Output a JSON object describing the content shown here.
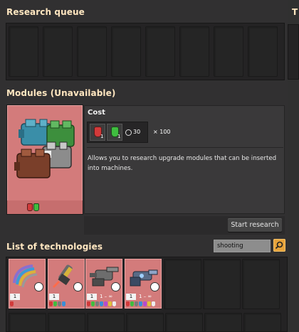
{
  "research_queue": {
    "title": "Research queue",
    "slots": 8
  },
  "header_cut": "T",
  "selected_tech": {
    "title": "Modules (Unavailable)",
    "cost_label": "Cost",
    "cost_items": [
      {
        "icon": "red-science-pack-icon",
        "count": "1",
        "color": "#d23a3a"
      },
      {
        "icon": "green-science-pack-icon",
        "count": "1",
        "color": "#3fbd3f"
      }
    ],
    "time": "30",
    "multiplier": "× 100",
    "description": "Allows you to research upgrade modules that can be inserted into machines.",
    "start_button": "Start research"
  },
  "technologies": {
    "title": "List of technologies",
    "search_value": "shooting",
    "cards": [
      {
        "name": "physical-projectile-damage",
        "level": "1",
        "range": ""
      },
      {
        "name": "weapon-shooting-speed",
        "level": "1",
        "range": ""
      },
      {
        "name": "stronger-explosives",
        "level": "1",
        "range": "1 – ∞"
      },
      {
        "name": "laser-shooting-speed",
        "level": "1",
        "range": "1 – ∞"
      }
    ]
  },
  "colors": {
    "accent_title": "#ffe6c0",
    "card_bg": "#d37b7b",
    "button_bg": "#454545",
    "search_button": "#e7a33b"
  }
}
